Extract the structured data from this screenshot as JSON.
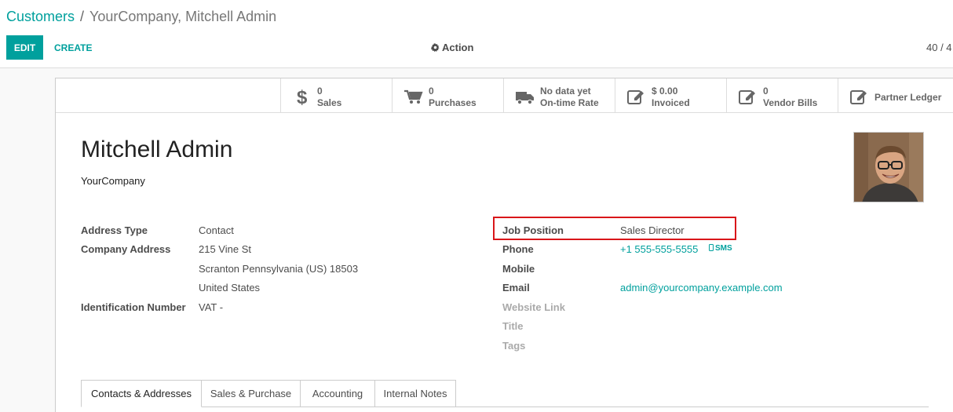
{
  "breadcrumb": {
    "parent": "Customers",
    "separator": "/",
    "current": "YourCompany, Mitchell Admin"
  },
  "toolbar": {
    "edit_label": "EDIT",
    "create_label": "CREATE",
    "action_label": "Action",
    "pager": "40 / 4"
  },
  "stat_buttons": [
    {
      "value": "0",
      "label": "Sales",
      "icon": "dollar-icon"
    },
    {
      "value": "0",
      "label": "Purchases",
      "icon": "cart-icon"
    },
    {
      "value": "No data yet",
      "label": "On-time Rate",
      "icon": "truck-icon"
    },
    {
      "value": "$ 0.00",
      "label": "Invoiced",
      "icon": "edit-icon"
    },
    {
      "value": "0",
      "label": "Vendor Bills",
      "icon": "edit-icon"
    },
    {
      "value": "",
      "label": "Partner Ledger",
      "icon": "edit-icon"
    }
  ],
  "partner": {
    "name": "Mitchell Admin",
    "company": "YourCompany"
  },
  "left_fields": {
    "address_type": {
      "label": "Address Type",
      "value": "Contact"
    },
    "company_address": {
      "label": "Company Address",
      "line1": "215 Vine St",
      "line2": "Scranton  Pennsylvania (US)  18503",
      "line3": "United States"
    },
    "identification": {
      "label": "Identification Number",
      "value": "VAT -"
    }
  },
  "right_fields": {
    "job_position": {
      "label": "Job Position",
      "value": "Sales Director"
    },
    "phone": {
      "label": "Phone",
      "value": "+1 555-555-5555",
      "sms": "SMS"
    },
    "mobile": {
      "label": "Mobile",
      "value": ""
    },
    "email": {
      "label": "Email",
      "value": "admin@yourcompany.example.com"
    },
    "website": {
      "label": "Website Link"
    },
    "title": {
      "label": "Title"
    },
    "tags": {
      "label": "Tags"
    }
  },
  "tabs": [
    "Contacts & Addresses",
    "Sales & Purchase",
    "Accounting",
    "Internal Notes"
  ],
  "colors": {
    "accent": "#00a09d",
    "highlight": "#d9161a"
  }
}
